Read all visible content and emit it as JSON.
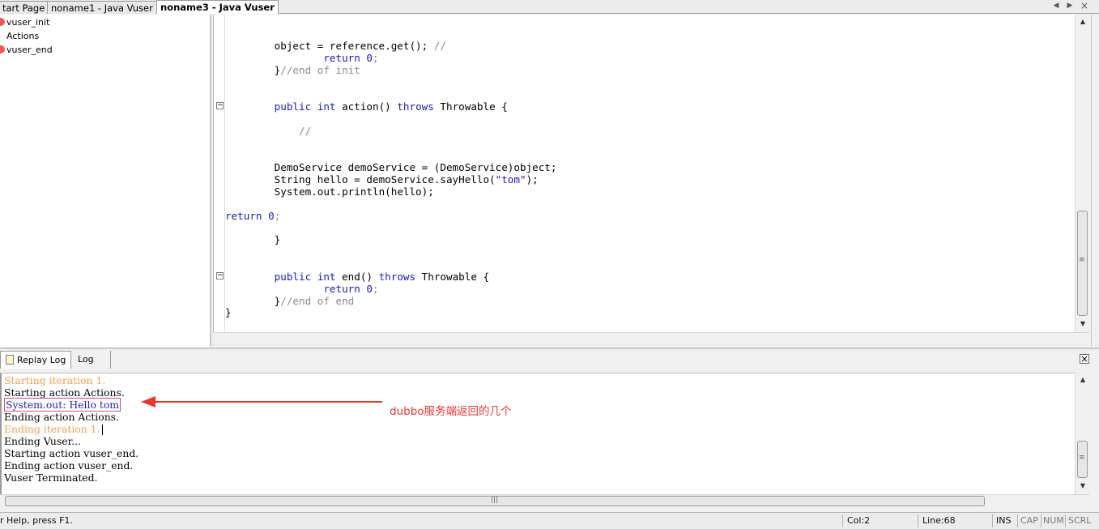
{
  "tabs": [
    {
      "label": "tart Page"
    },
    {
      "label": "noname1 - Java Vuser"
    },
    {
      "label": "noname3 - Java Vuser",
      "active": true
    }
  ],
  "tree": {
    "items": [
      {
        "label": "vuser_init",
        "icon": "script-icon"
      },
      {
        "label": "Actions",
        "icon": "none"
      },
      {
        "label": "vuser_end",
        "icon": "script-icon"
      }
    ]
  },
  "code": {
    "l1": {
      "a": "        object = reference.get(); ",
      "c": "//"
    },
    "l2": {
      "k": "return",
      "n": "0",
      "t": ";"
    },
    "l3": {
      "t": "}",
      "c": "//end of init"
    },
    "l4": {
      "k1": "public",
      "k2": "int",
      "t1": " action() ",
      "k3": "throws",
      "t2": " Throwable {"
    },
    "l5": {
      "c": "//"
    },
    "l6": {
      "t": "DemoService demoService = (DemoService)object;"
    },
    "l7": {
      "t1": "String hello = demoService.sayHello(",
      "s": "\"tom\"",
      "t2": ");"
    },
    "l8": {
      "t": "System.out.println(hello);"
    },
    "l9": {
      "k": "return",
      "n": "0",
      "t": ";"
    },
    "l10": {
      "t": "}"
    },
    "l11": {
      "k1": "public",
      "k2": "int",
      "t1": " end() ",
      "k3": "throws",
      "t2": " Throwable {"
    },
    "l12": {
      "k": "return",
      "n": "0",
      "t": ";"
    },
    "l13": {
      "t": "}",
      "c": "//end of end"
    },
    "l14": {
      "t": "}"
    }
  },
  "output": {
    "tabs": [
      {
        "label": "Replay Log"
      },
      {
        "label": "Log"
      }
    ],
    "close_label": "×",
    "lines": {
      "l1": "Starting iteration 1.",
      "l2": "Starting action Actions.",
      "l3": "System.out: Hello tom",
      "l4": "Ending action Actions.",
      "l5": "Ending iteration 1.",
      "l6": "Ending Vuser...",
      "l7": "Starting action vuser_end.",
      "l8": "Ending action vuser_end.",
      "l9": "Vuser Terminated."
    },
    "annotation": "dubbo服务端返回的几个",
    "annotation_color": "#e8362f"
  },
  "status": {
    "help": "r Help, press F1.",
    "col": "Col:2",
    "line": "Line:68",
    "ins": "INS",
    "cap": "CAP",
    "num": "NUM",
    "scrl": "SCRL"
  },
  "colors": {
    "keyword": "#1a1ab8",
    "comment": "#8a8a8a",
    "log_orange": "#f0a050"
  }
}
